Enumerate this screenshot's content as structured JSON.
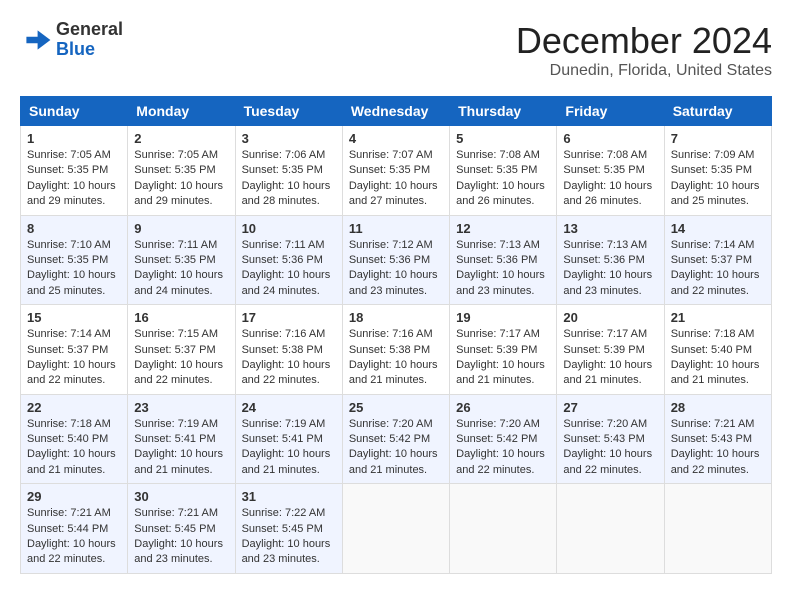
{
  "header": {
    "logo_general": "General",
    "logo_blue": "Blue",
    "month": "December 2024",
    "location": "Dunedin, Florida, United States"
  },
  "weekdays": [
    "Sunday",
    "Monday",
    "Tuesday",
    "Wednesday",
    "Thursday",
    "Friday",
    "Saturday"
  ],
  "weeks": [
    [
      {
        "day": "1",
        "info": "Sunrise: 7:05 AM\nSunset: 5:35 PM\nDaylight: 10 hours\nand 29 minutes."
      },
      {
        "day": "2",
        "info": "Sunrise: 7:05 AM\nSunset: 5:35 PM\nDaylight: 10 hours\nand 29 minutes."
      },
      {
        "day": "3",
        "info": "Sunrise: 7:06 AM\nSunset: 5:35 PM\nDaylight: 10 hours\nand 28 minutes."
      },
      {
        "day": "4",
        "info": "Sunrise: 7:07 AM\nSunset: 5:35 PM\nDaylight: 10 hours\nand 27 minutes."
      },
      {
        "day": "5",
        "info": "Sunrise: 7:08 AM\nSunset: 5:35 PM\nDaylight: 10 hours\nand 26 minutes."
      },
      {
        "day": "6",
        "info": "Sunrise: 7:08 AM\nSunset: 5:35 PM\nDaylight: 10 hours\nand 26 minutes."
      },
      {
        "day": "7",
        "info": "Sunrise: 7:09 AM\nSunset: 5:35 PM\nDaylight: 10 hours\nand 25 minutes."
      }
    ],
    [
      {
        "day": "8",
        "info": "Sunrise: 7:10 AM\nSunset: 5:35 PM\nDaylight: 10 hours\nand 25 minutes."
      },
      {
        "day": "9",
        "info": "Sunrise: 7:11 AM\nSunset: 5:35 PM\nDaylight: 10 hours\nand 24 minutes."
      },
      {
        "day": "10",
        "info": "Sunrise: 7:11 AM\nSunset: 5:36 PM\nDaylight: 10 hours\nand 24 minutes."
      },
      {
        "day": "11",
        "info": "Sunrise: 7:12 AM\nSunset: 5:36 PM\nDaylight: 10 hours\nand 23 minutes."
      },
      {
        "day": "12",
        "info": "Sunrise: 7:13 AM\nSunset: 5:36 PM\nDaylight: 10 hours\nand 23 minutes."
      },
      {
        "day": "13",
        "info": "Sunrise: 7:13 AM\nSunset: 5:36 PM\nDaylight: 10 hours\nand 23 minutes."
      },
      {
        "day": "14",
        "info": "Sunrise: 7:14 AM\nSunset: 5:37 PM\nDaylight: 10 hours\nand 22 minutes."
      }
    ],
    [
      {
        "day": "15",
        "info": "Sunrise: 7:14 AM\nSunset: 5:37 PM\nDaylight: 10 hours\nand 22 minutes."
      },
      {
        "day": "16",
        "info": "Sunrise: 7:15 AM\nSunset: 5:37 PM\nDaylight: 10 hours\nand 22 minutes."
      },
      {
        "day": "17",
        "info": "Sunrise: 7:16 AM\nSunset: 5:38 PM\nDaylight: 10 hours\nand 22 minutes."
      },
      {
        "day": "18",
        "info": "Sunrise: 7:16 AM\nSunset: 5:38 PM\nDaylight: 10 hours\nand 21 minutes."
      },
      {
        "day": "19",
        "info": "Sunrise: 7:17 AM\nSunset: 5:39 PM\nDaylight: 10 hours\nand 21 minutes."
      },
      {
        "day": "20",
        "info": "Sunrise: 7:17 AM\nSunset: 5:39 PM\nDaylight: 10 hours\nand 21 minutes."
      },
      {
        "day": "21",
        "info": "Sunrise: 7:18 AM\nSunset: 5:40 PM\nDaylight: 10 hours\nand 21 minutes."
      }
    ],
    [
      {
        "day": "22",
        "info": "Sunrise: 7:18 AM\nSunset: 5:40 PM\nDaylight: 10 hours\nand 21 minutes."
      },
      {
        "day": "23",
        "info": "Sunrise: 7:19 AM\nSunset: 5:41 PM\nDaylight: 10 hours\nand 21 minutes."
      },
      {
        "day": "24",
        "info": "Sunrise: 7:19 AM\nSunset: 5:41 PM\nDaylight: 10 hours\nand 21 minutes."
      },
      {
        "day": "25",
        "info": "Sunrise: 7:20 AM\nSunset: 5:42 PM\nDaylight: 10 hours\nand 21 minutes."
      },
      {
        "day": "26",
        "info": "Sunrise: 7:20 AM\nSunset: 5:42 PM\nDaylight: 10 hours\nand 22 minutes."
      },
      {
        "day": "27",
        "info": "Sunrise: 7:20 AM\nSunset: 5:43 PM\nDaylight: 10 hours\nand 22 minutes."
      },
      {
        "day": "28",
        "info": "Sunrise: 7:21 AM\nSunset: 5:43 PM\nDaylight: 10 hours\nand 22 minutes."
      }
    ],
    [
      {
        "day": "29",
        "info": "Sunrise: 7:21 AM\nSunset: 5:44 PM\nDaylight: 10 hours\nand 22 minutes."
      },
      {
        "day": "30",
        "info": "Sunrise: 7:21 AM\nSunset: 5:45 PM\nDaylight: 10 hours\nand 23 minutes."
      },
      {
        "day": "31",
        "info": "Sunrise: 7:22 AM\nSunset: 5:45 PM\nDaylight: 10 hours\nand 23 minutes."
      },
      {
        "day": "",
        "info": ""
      },
      {
        "day": "",
        "info": ""
      },
      {
        "day": "",
        "info": ""
      },
      {
        "day": "",
        "info": ""
      }
    ]
  ]
}
